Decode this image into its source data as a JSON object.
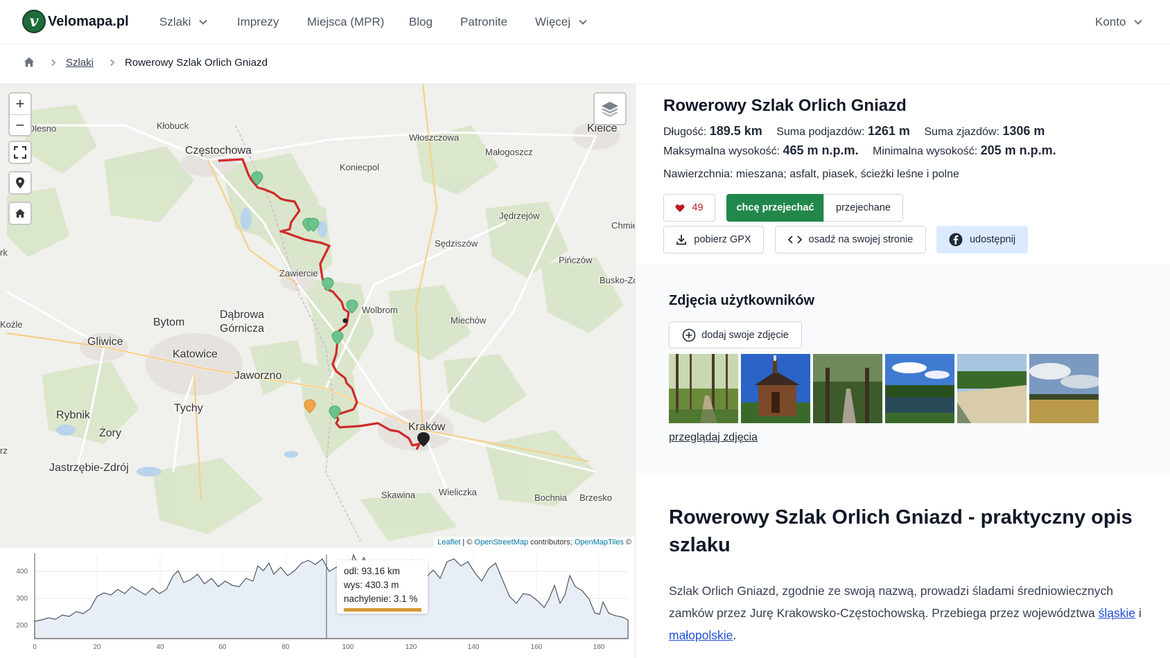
{
  "header": {
    "logo": "Velomapa.pl",
    "logo_letter": "v",
    "nav": [
      "Szlaki",
      "Imprezy",
      "Miejsca (MPR)",
      "Blog",
      "Patronite",
      "Więcej"
    ],
    "account": "Konto"
  },
  "breadcrumb": {
    "items": [
      "Szlaki",
      "Rowerowy Szlak Orlich Gniazd"
    ]
  },
  "map": {
    "labels": [
      "Kłobuck",
      "Olesno",
      "Częstochowa",
      "Koniecpol",
      "Włoszczowa",
      "Małogoszcz",
      "Kielce",
      "Jędrzejów",
      "Chmie",
      "Sędziszów",
      "Pińczów",
      "Busko-Zd",
      "Zawiercie",
      "Wolbrom",
      "Miechów",
      "Koźle",
      "Bytom",
      "Dąbrowa",
      "Górnicza",
      "Gliwice",
      "Katowice",
      "Jaworzno",
      "Tychy",
      "Rybnik",
      "Żory",
      "Jastrzębie-Zdrój",
      "Kraków",
      "Skawina",
      "Wieliczka",
      "Bochnia",
      "Brzesko",
      "rk",
      "rz"
    ],
    "zoom_in": "+",
    "zoom_out": "−",
    "attribution": {
      "leaflet": "Leaflet",
      "sep": " | © ",
      "osm": "OpenStreetMap",
      "contrib": " contributors; ",
      "omt": "OpenMapTiles",
      "end": " ©"
    }
  },
  "elevation": {
    "y_ticks": [
      "400",
      "300",
      "200"
    ],
    "x_ticks": [
      "0",
      "20",
      "40",
      "60",
      "80",
      "100",
      "120",
      "140",
      "160",
      "180"
    ],
    "tooltip": {
      "distance": "odl: 93.16 km",
      "elevation": "wys: 430.3 m",
      "slope": "nachylenie: 3.1 %"
    },
    "slope_color": "#d59b33"
  },
  "trail": {
    "title": "Rowerowy Szlak Orlich Gniazd",
    "length_label": "Długość:",
    "length": "189.5 km",
    "ascent_label": "Suma podjazdów:",
    "ascent": "1261 m",
    "descent_label": "Suma zjazdów:",
    "descent": "1306 m",
    "max_label": "Maksymalna wysokość:",
    "max": "465 m n.p.m.",
    "min_label": "Minimalna wysokość:",
    "min": "205 m n.p.m.",
    "surface": "Nawierzchnia: mieszana; asfalt, piasek, ścieżki leśne i polne",
    "route_color": "#d02a2a"
  },
  "actions": {
    "likes": "49",
    "want": "chcę przejechać",
    "done": "przejechane",
    "gpx": "pobierz GPX",
    "embed": "osadź na swojej stronie",
    "share": "udostępnij",
    "accent": "#21874b"
  },
  "photos": {
    "title": "Zdjęcia użytkowników",
    "add": "dodaj swoje zdjęcie",
    "browse": "przeglądaj zdjęcia"
  },
  "description": {
    "title": "Rowerowy Szlak Orlich Gniazd - praktyczny opis szlaku",
    "text_1": "Szlak Orlich Gniazd, zgodnie ze swoją nazwą, prowadzi śladami średniowiecznych zamków przez Jurę Krakowsko-Częstochowską. Przebiega przez województwa ",
    "link_1": "śląskie",
    "text_2": " i ",
    "link_2": "małopolskie",
    "text_3": "."
  }
}
